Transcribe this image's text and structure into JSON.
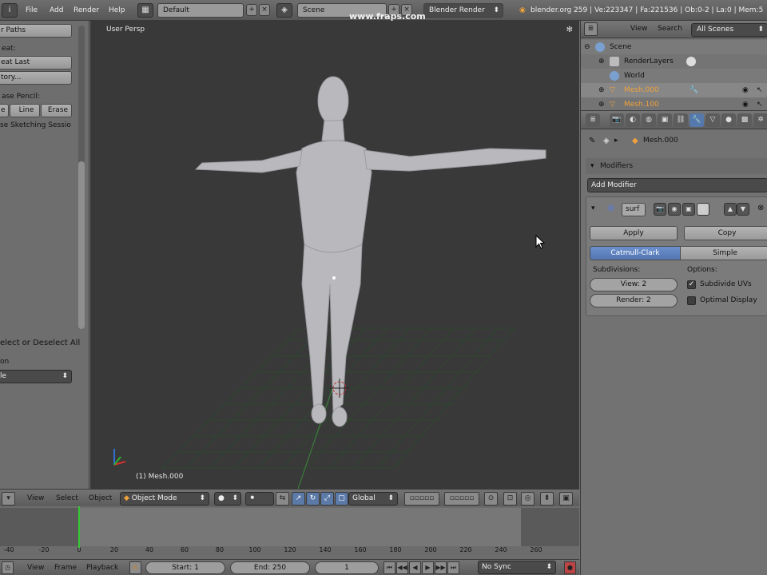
{
  "topbar": {
    "menus": [
      "File",
      "Add",
      "Render",
      "Help"
    ],
    "layout": "Default",
    "scene": "Scene",
    "engine": "Blender Render",
    "stats": "blender.org 259 | Ve:223347 | Fa:221536 | Ob:0-2 | La:0 | Mem:5"
  },
  "watermark": "www.fraps.com",
  "toolshelf": {
    "btn_paths": "r Paths",
    "lbl_repeat": "eat:",
    "btn_repeat_last": "eat Last",
    "btn_history": "tory...",
    "lbl_grease": "ase Pencil:",
    "btn_draw": "e",
    "btn_line": "Line",
    "btn_erase": "Erase",
    "lbl_sketch": "se Sketching Sessio",
    "lbl_select": "elect or Deselect All",
    "lbl_action": "on",
    "sel_action": "le"
  },
  "viewport": {
    "title": "User Persp",
    "object_label": "(1) Mesh.000"
  },
  "view3d_header": {
    "view": "View",
    "select": "Select",
    "object": "Object",
    "mode": "Object Mode",
    "orientation": "Global"
  },
  "timeline": {
    "ticks": [
      "-40",
      "-20",
      "0",
      "20",
      "40",
      "60",
      "80",
      "100",
      "120",
      "140",
      "160",
      "180",
      "200",
      "220",
      "240",
      "260"
    ],
    "current_frame_value": 0,
    "header": {
      "view": "View",
      "frame": "Frame",
      "playback": "Playback",
      "start": "Start: 1",
      "end": "End: 250",
      "current": "1",
      "sync": "No Sync"
    }
  },
  "outliner": {
    "view": "View",
    "search": "Search",
    "filter": "All Scenes",
    "rows": [
      {
        "label": "Scene",
        "color": "#111111"
      },
      {
        "label": "RenderLayers",
        "color": "#111111"
      },
      {
        "label": "World",
        "color": "#111111"
      },
      {
        "label": "Mesh.000",
        "color": "#f0a23a"
      },
      {
        "label": "Mesh.100",
        "color": "#f0a23a"
      }
    ]
  },
  "properties": {
    "context_object": "Mesh.000",
    "panel_title": "Modifiers",
    "add_modifier": "Add Modifier",
    "modifier_name": "surf",
    "apply": "Apply",
    "copy": "Copy",
    "tab_catmull": "Catmull-Clark",
    "tab_simple": "Simple",
    "subdivisions_label": "Subdivisions:",
    "options_label": "Options:",
    "view_levels": "View: 2",
    "render_levels": "Render: 2",
    "subdivide_uvs": "Subdivide UVs",
    "optimal_display": "Optimal Display",
    "subdivide_uvs_checked": true,
    "optimal_display_checked": false
  },
  "colors": {
    "accent_blue": "#5679ad",
    "object_orange": "#f0a23a",
    "frame_green": "#35c835",
    "viewport_bg": "#393939"
  }
}
